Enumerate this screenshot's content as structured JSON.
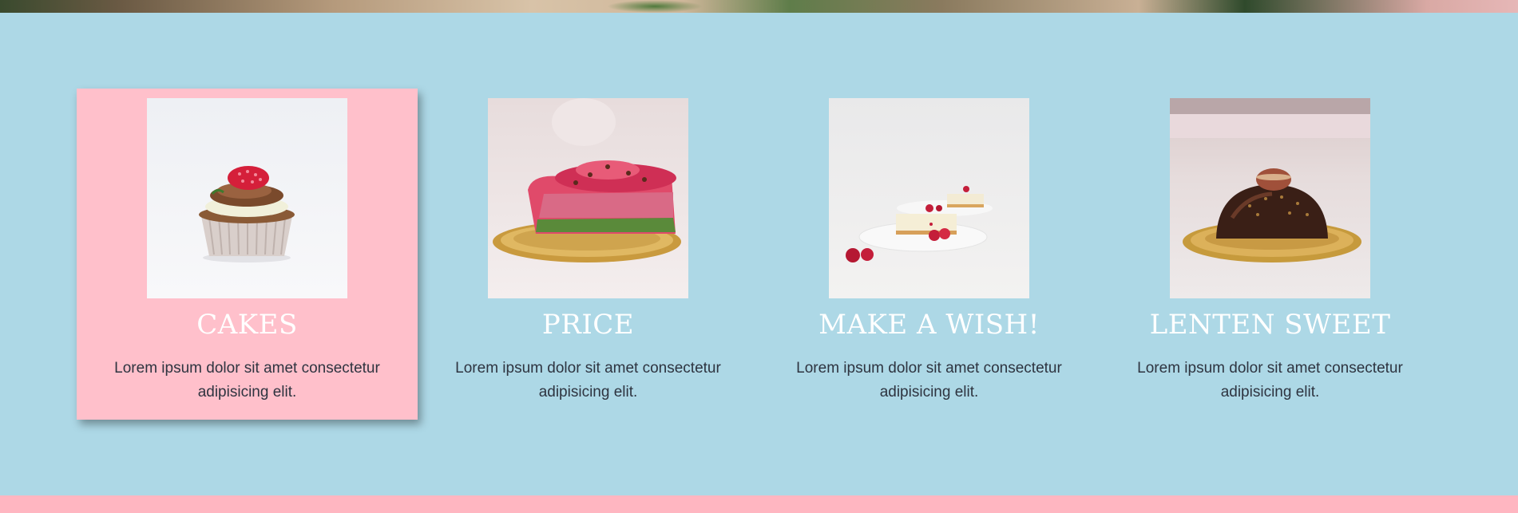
{
  "colors": {
    "section_background": "#add8e6",
    "active_card_background": "#ffc0cb",
    "title_color": "#ffffff",
    "text_color": "#2e3440",
    "footer_strip": "#ffb6c1"
  },
  "hero": {
    "image_icon": "hero-photo-strip"
  },
  "features": {
    "cards": [
      {
        "title": "CAKES",
        "text": "Lorem ipsum dolor sit amet consectetur adipisicing elit.",
        "image_icon": "cupcake-photo",
        "active": true
      },
      {
        "title": "PRICE",
        "text": "Lorem ipsum dolor sit amet consectetur adipisicing elit.",
        "image_icon": "raspberry-mousse-cake-photo",
        "active": false
      },
      {
        "title": "MAKE A WISH!",
        "text": "Lorem ipsum dolor sit amet consectetur adipisicing elit.",
        "image_icon": "cheesecake-slice-photo",
        "active": false
      },
      {
        "title": "LENTEN SWEET",
        "text": "Lorem ipsum dolor sit amet consectetur adipisicing elit.",
        "image_icon": "chocolate-dome-cake-photo",
        "active": false
      }
    ]
  }
}
